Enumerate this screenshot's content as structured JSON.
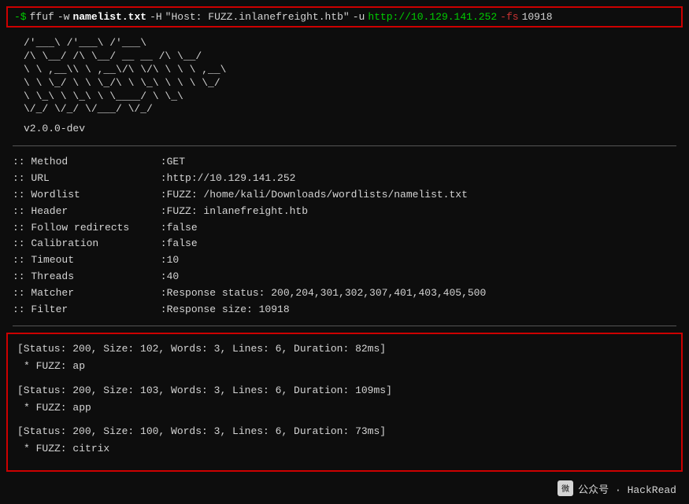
{
  "terminal": {
    "command": {
      "prompt": "-$",
      "tool": "ffuf",
      "flag_w": "-w",
      "wordlist": "namelist.txt",
      "flag_H": "-H",
      "host_header": "\"Host: FUZZ.inlanefreight.htb\"",
      "flag_u": "-u",
      "url": "http://10.129.141.252",
      "flag_fs": "-fs",
      "filter_size": "10918"
    },
    "ascii_art": [
      "        /'___\\  /'___\\           /'___\\       ",
      "       /\\ \\__/ /\\ \\__/  __  __  /\\ \\__/       ",
      "       \\ \\ ,__\\\\ \\ ,__\\/\\ \\/\\ \\ \\ \\ ,__\\      ",
      "        \\ \\ \\_/ \\ \\ \\_/\\ \\ \\_\\ \\ \\ \\ \\_/      ",
      "         \\ \\_\\   \\ \\_\\  \\ \\____/  \\ \\_\\       ",
      "          \\/_/    \\/_/   \\/___/    \\/_/       "
    ],
    "version": "v2.0.0-dev",
    "config": {
      "method_label": ":: Method",
      "method_value": "GET",
      "url_label": ":: URL",
      "url_value": "http://10.129.141.252",
      "wordlist_label": ":: Wordlist",
      "wordlist_value": "FUZZ: /home/kali/Downloads/wordlists/namelist.txt",
      "header_label": ":: Header",
      "header_value": "FUZZ: inlanefreight.htb",
      "follow_label": ":: Follow redirects",
      "follow_value": "false",
      "calibration_label": ":: Calibration",
      "calibration_value": "false",
      "timeout_label": ":: Timeout",
      "timeout_value": "10",
      "threads_label": ":: Threads",
      "threads_value": "40",
      "matcher_label": ":: Matcher",
      "matcher_value": "Response status: 200,204,301,302,307,401,403,405,500",
      "filter_label": ":: Filter",
      "filter_value": "Response size: 10918"
    },
    "results": [
      {
        "status_line": "[Status: 200, Size: 102, Words: 3, Lines: 6, Duration: 82ms]",
        "fuzz_line": "* FUZZ: ap"
      },
      {
        "status_line": "[Status: 200, Size: 103, Words: 3, Lines: 6, Duration: 109ms]",
        "fuzz_line": "* FUZZ: app"
      },
      {
        "status_line": "[Status: 200, Size: 100, Words: 3, Lines: 6, Duration: 73ms]",
        "fuzz_line": "* FUZZ: citrix"
      }
    ],
    "watermark": "公众号 · HackRead"
  }
}
